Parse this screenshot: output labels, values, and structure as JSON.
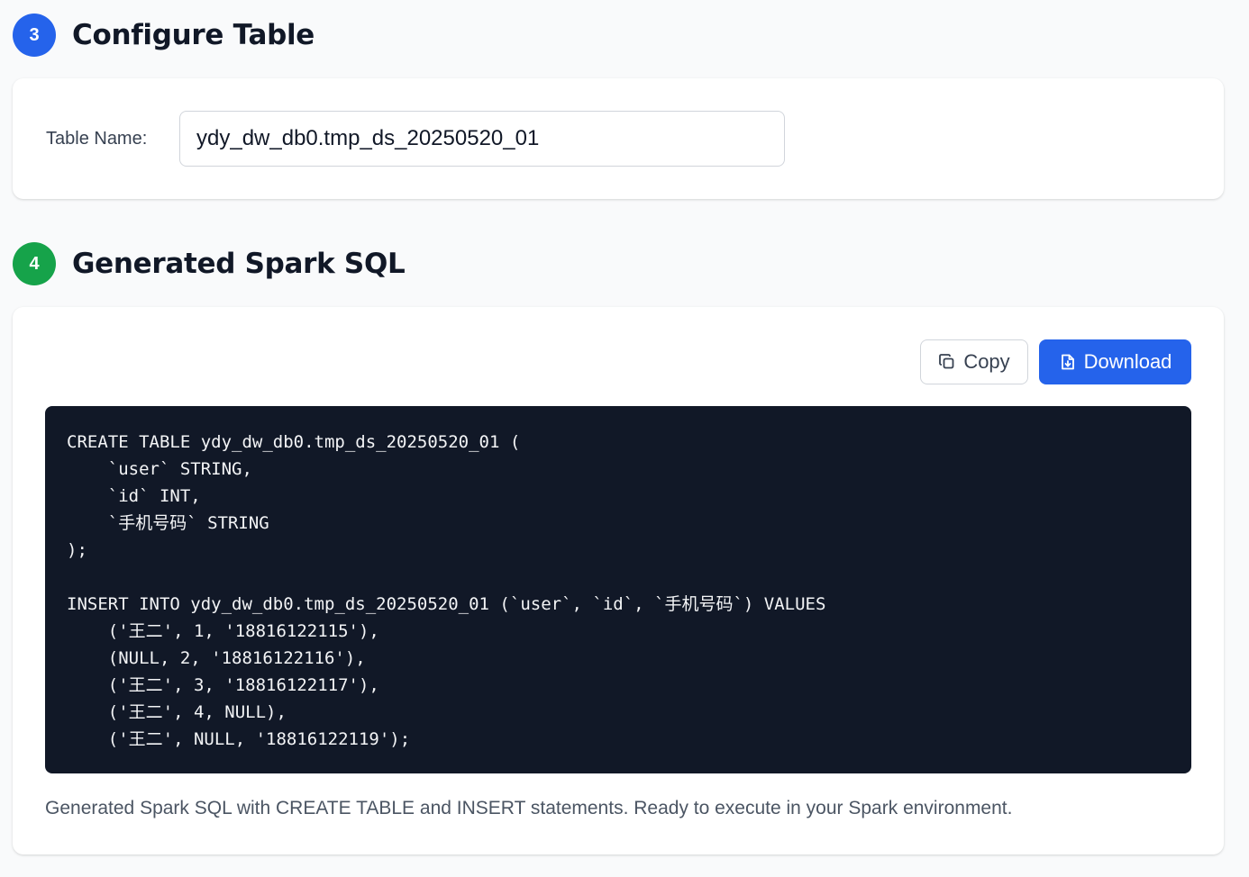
{
  "step3": {
    "number": "3",
    "title": "Configure Table",
    "color": "#2563eb"
  },
  "table_config": {
    "label": "Table Name:",
    "value": "ydy_dw_db0.tmp_ds_20250520_01"
  },
  "step4": {
    "number": "4",
    "title": "Generated Spark SQL",
    "color": "#16a34a"
  },
  "actions": {
    "copy_label": "Copy",
    "copy_icon": "copy-icon",
    "download_label": "Download",
    "download_icon": "file-download-icon",
    "download_color": "#2563eb"
  },
  "sql": {
    "lines": [
      "CREATE TABLE ydy_dw_db0.tmp_ds_20250520_01 (",
      "    `user` STRING,",
      "    `id` INT,",
      "    `手机号码` STRING",
      ");",
      "",
      "INSERT INTO ydy_dw_db0.tmp_ds_20250520_01 (`user`, `id`, `手机号码`) VALUES",
      "    ('王二', 1, '18816122115'),",
      "    (NULL, 2, '18816122116'),",
      "    ('王二', 3, '18816122117'),",
      "    ('王二', 4, NULL),",
      "    ('王二', NULL, '18816122119');"
    ]
  },
  "caption": "Generated Spark SQL with CREATE TABLE and INSERT statements. Ready to execute in your Spark environment."
}
